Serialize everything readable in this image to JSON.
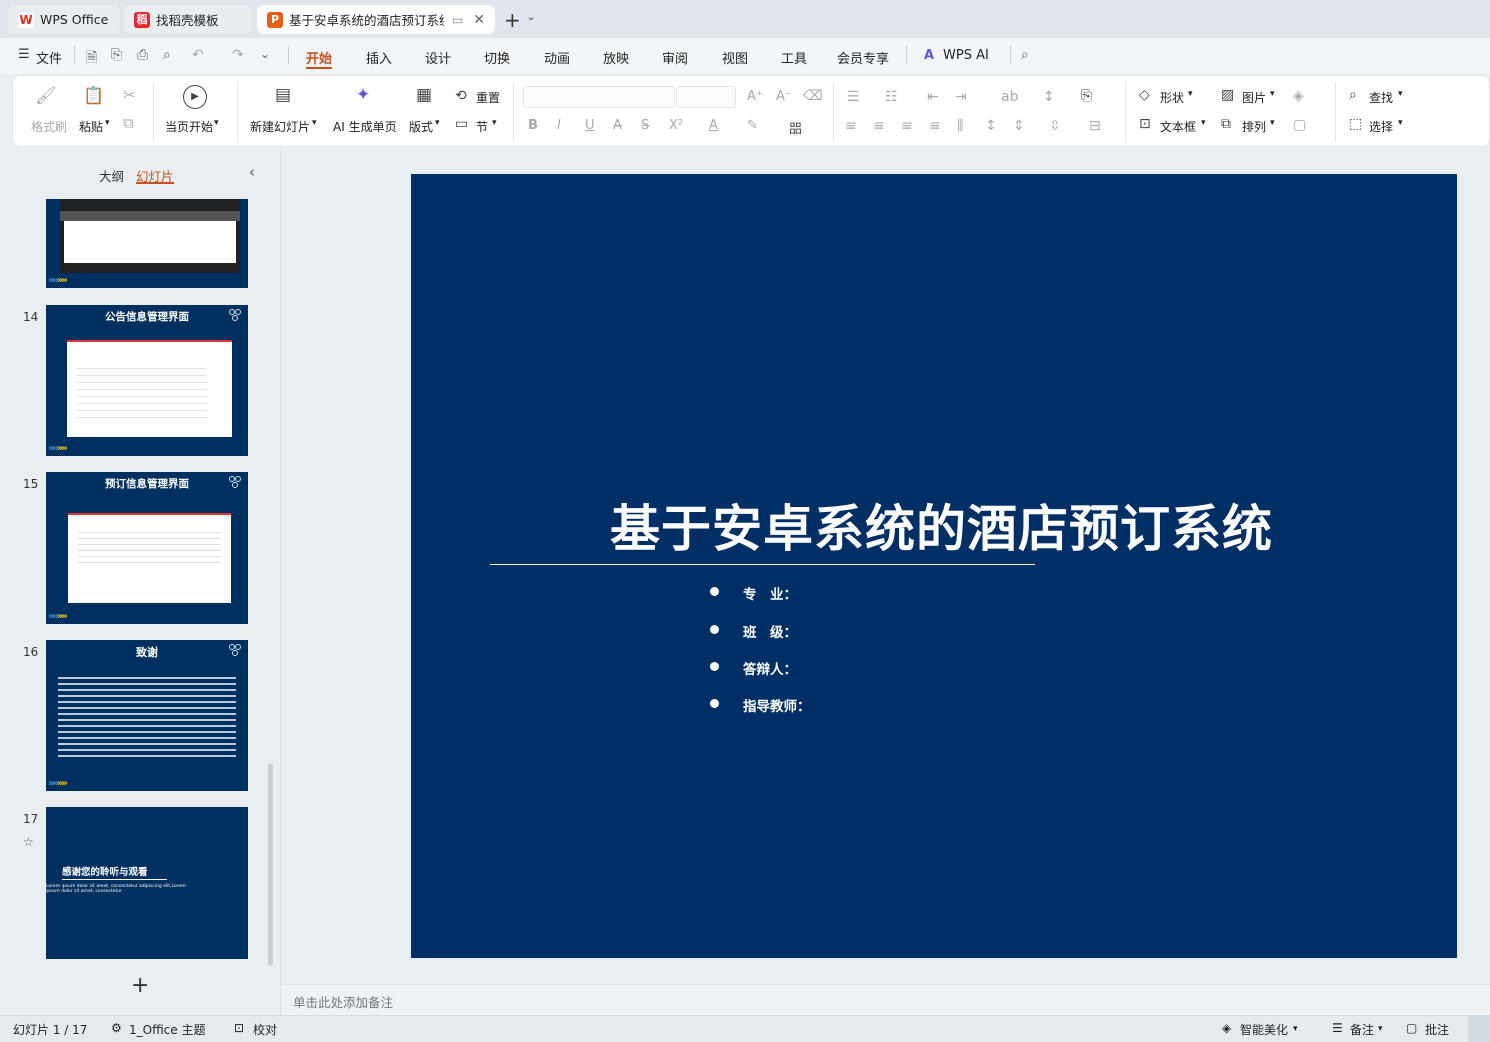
{
  "tabs": [
    {
      "label": "WPS Office"
    },
    {
      "label": "找稻壳模板"
    },
    {
      "label": "基于安卓系统的酒店预订系统"
    }
  ],
  "menu": {
    "file": "文件",
    "items": [
      "开始",
      "插入",
      "设计",
      "切换",
      "动画",
      "放映",
      "审阅",
      "视图",
      "工具",
      "会员专享"
    ],
    "wps_ai": "WPS AI"
  },
  "ribbon": {
    "format_painter": "格式刷",
    "paste": "粘贴",
    "start_from_current": "当页开始",
    "new_slide": "新建幻灯片",
    "ai_generate": "AI 生成单页",
    "layout": "版式",
    "reset": "重置",
    "section": "节",
    "shape": "形状",
    "picture": "图片",
    "textbox": "文本框",
    "arrange": "排列",
    "find": "查找",
    "select": "选择"
  },
  "panel": {
    "outline_tab": "大纲",
    "slides_tab": "幻灯片",
    "thumbs": [
      {
        "num": "14",
        "title": "公告信息管理界面"
      },
      {
        "num": "15",
        "title": "预订信息管理界面"
      },
      {
        "num": "16",
        "title": "致谢"
      },
      {
        "num": "17",
        "title": "感谢您的聆听与观看",
        "sub": "Lorem ipsum dolor sit amet, consectetur adipiscing elit,Lorem ipsum dolor sit amet, consectetur"
      }
    ]
  },
  "slide": {
    "title": "基于安卓系统的酒店预订系统",
    "bullets": [
      "专　业：",
      "班　级：",
      "答辩人：",
      "指导教师："
    ]
  },
  "notes_placeholder": "单击此处添加备注",
  "status": {
    "slide_counter": "幻灯片 1 / 17",
    "theme": "1_Office 主题",
    "proofing": "校对",
    "smart_beautify": "智能美化",
    "notes": "备注",
    "comments": "批注"
  }
}
